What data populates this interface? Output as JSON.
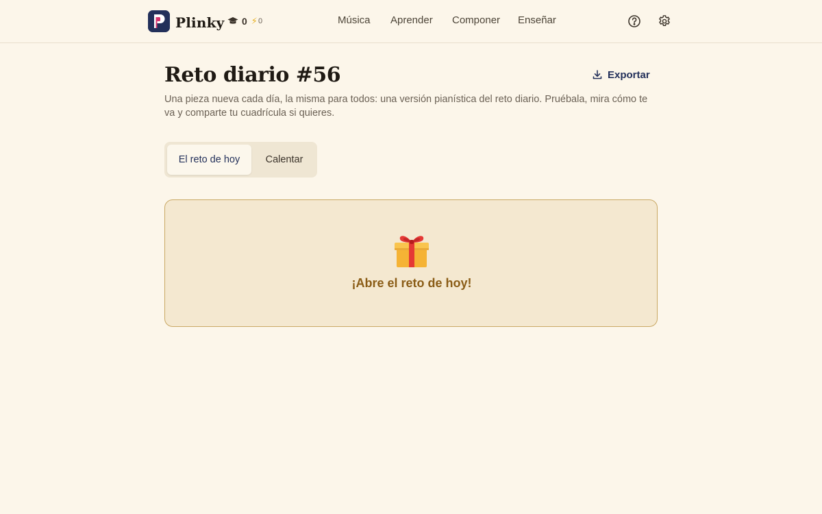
{
  "header": {
    "brand": "Plinky",
    "stats": {
      "graduation_value": "0",
      "energy_value": "0"
    },
    "nav": [
      "Música",
      "Aprender",
      "Componer",
      "Enseñar"
    ],
    "icons": [
      "help-circle-icon",
      "gear-icon"
    ]
  },
  "page": {
    "title": "Reto diario #56",
    "export_label": "Exportar",
    "subtitle": "Una pieza nueva cada día, la misma para todos: una versión pianística del reto diario. Pruébala, mira cómo te va y comparte tu cuadrícula si quieres.",
    "tabs": [
      {
        "label": "El reto de hoy",
        "active": true
      },
      {
        "label": "Calentar",
        "active": false
      }
    ],
    "card": {
      "icon": "gift-icon",
      "label": "¡Abre el reto de hoy!"
    }
  },
  "colors": {
    "background": "#fcf6ea",
    "brand_navy": "#23305a",
    "brand_pink": "#d6336c",
    "card_bg": "#f4e8d0",
    "card_border": "#c9a864",
    "card_text": "#8a5c16"
  }
}
